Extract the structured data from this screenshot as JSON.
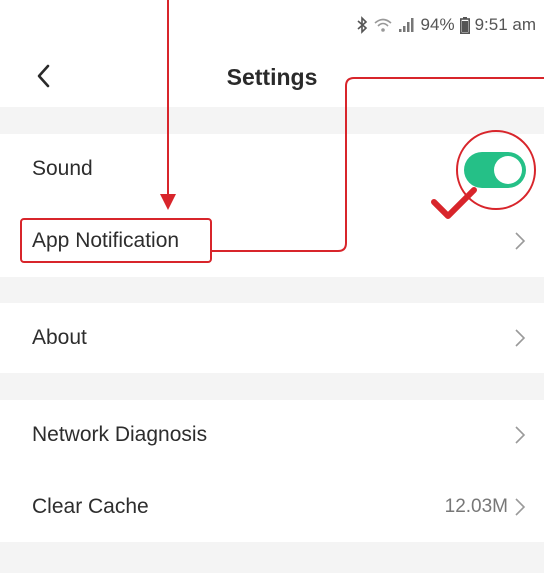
{
  "status_bar": {
    "battery": "94%",
    "time": "9:51 am"
  },
  "header": {
    "back_icon": "chevron-left-icon",
    "title": "Settings"
  },
  "settings": {
    "sound": {
      "label": "Sound",
      "enabled": true
    },
    "app_notification": {
      "label": "App Notification"
    },
    "about": {
      "label": "About"
    },
    "network_diagnosis": {
      "label": "Network Diagnosis"
    },
    "clear_cache": {
      "label": "Clear Cache",
      "value": "12.03M"
    }
  },
  "colors": {
    "toggle_on": "#25c087",
    "annotation": "#d8252b",
    "section_gap": "#f4f4f4"
  }
}
